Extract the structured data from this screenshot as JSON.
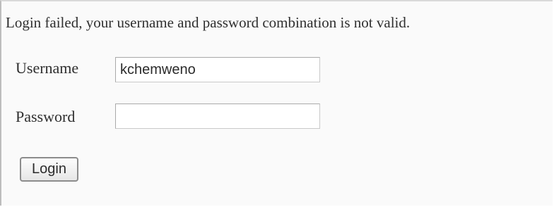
{
  "error_message": "Login failed, your username and password combination is not valid.",
  "form": {
    "username": {
      "label": "Username",
      "value": "kchemweno"
    },
    "password": {
      "label": "Password",
      "value": ""
    },
    "submit_label": "Login"
  }
}
